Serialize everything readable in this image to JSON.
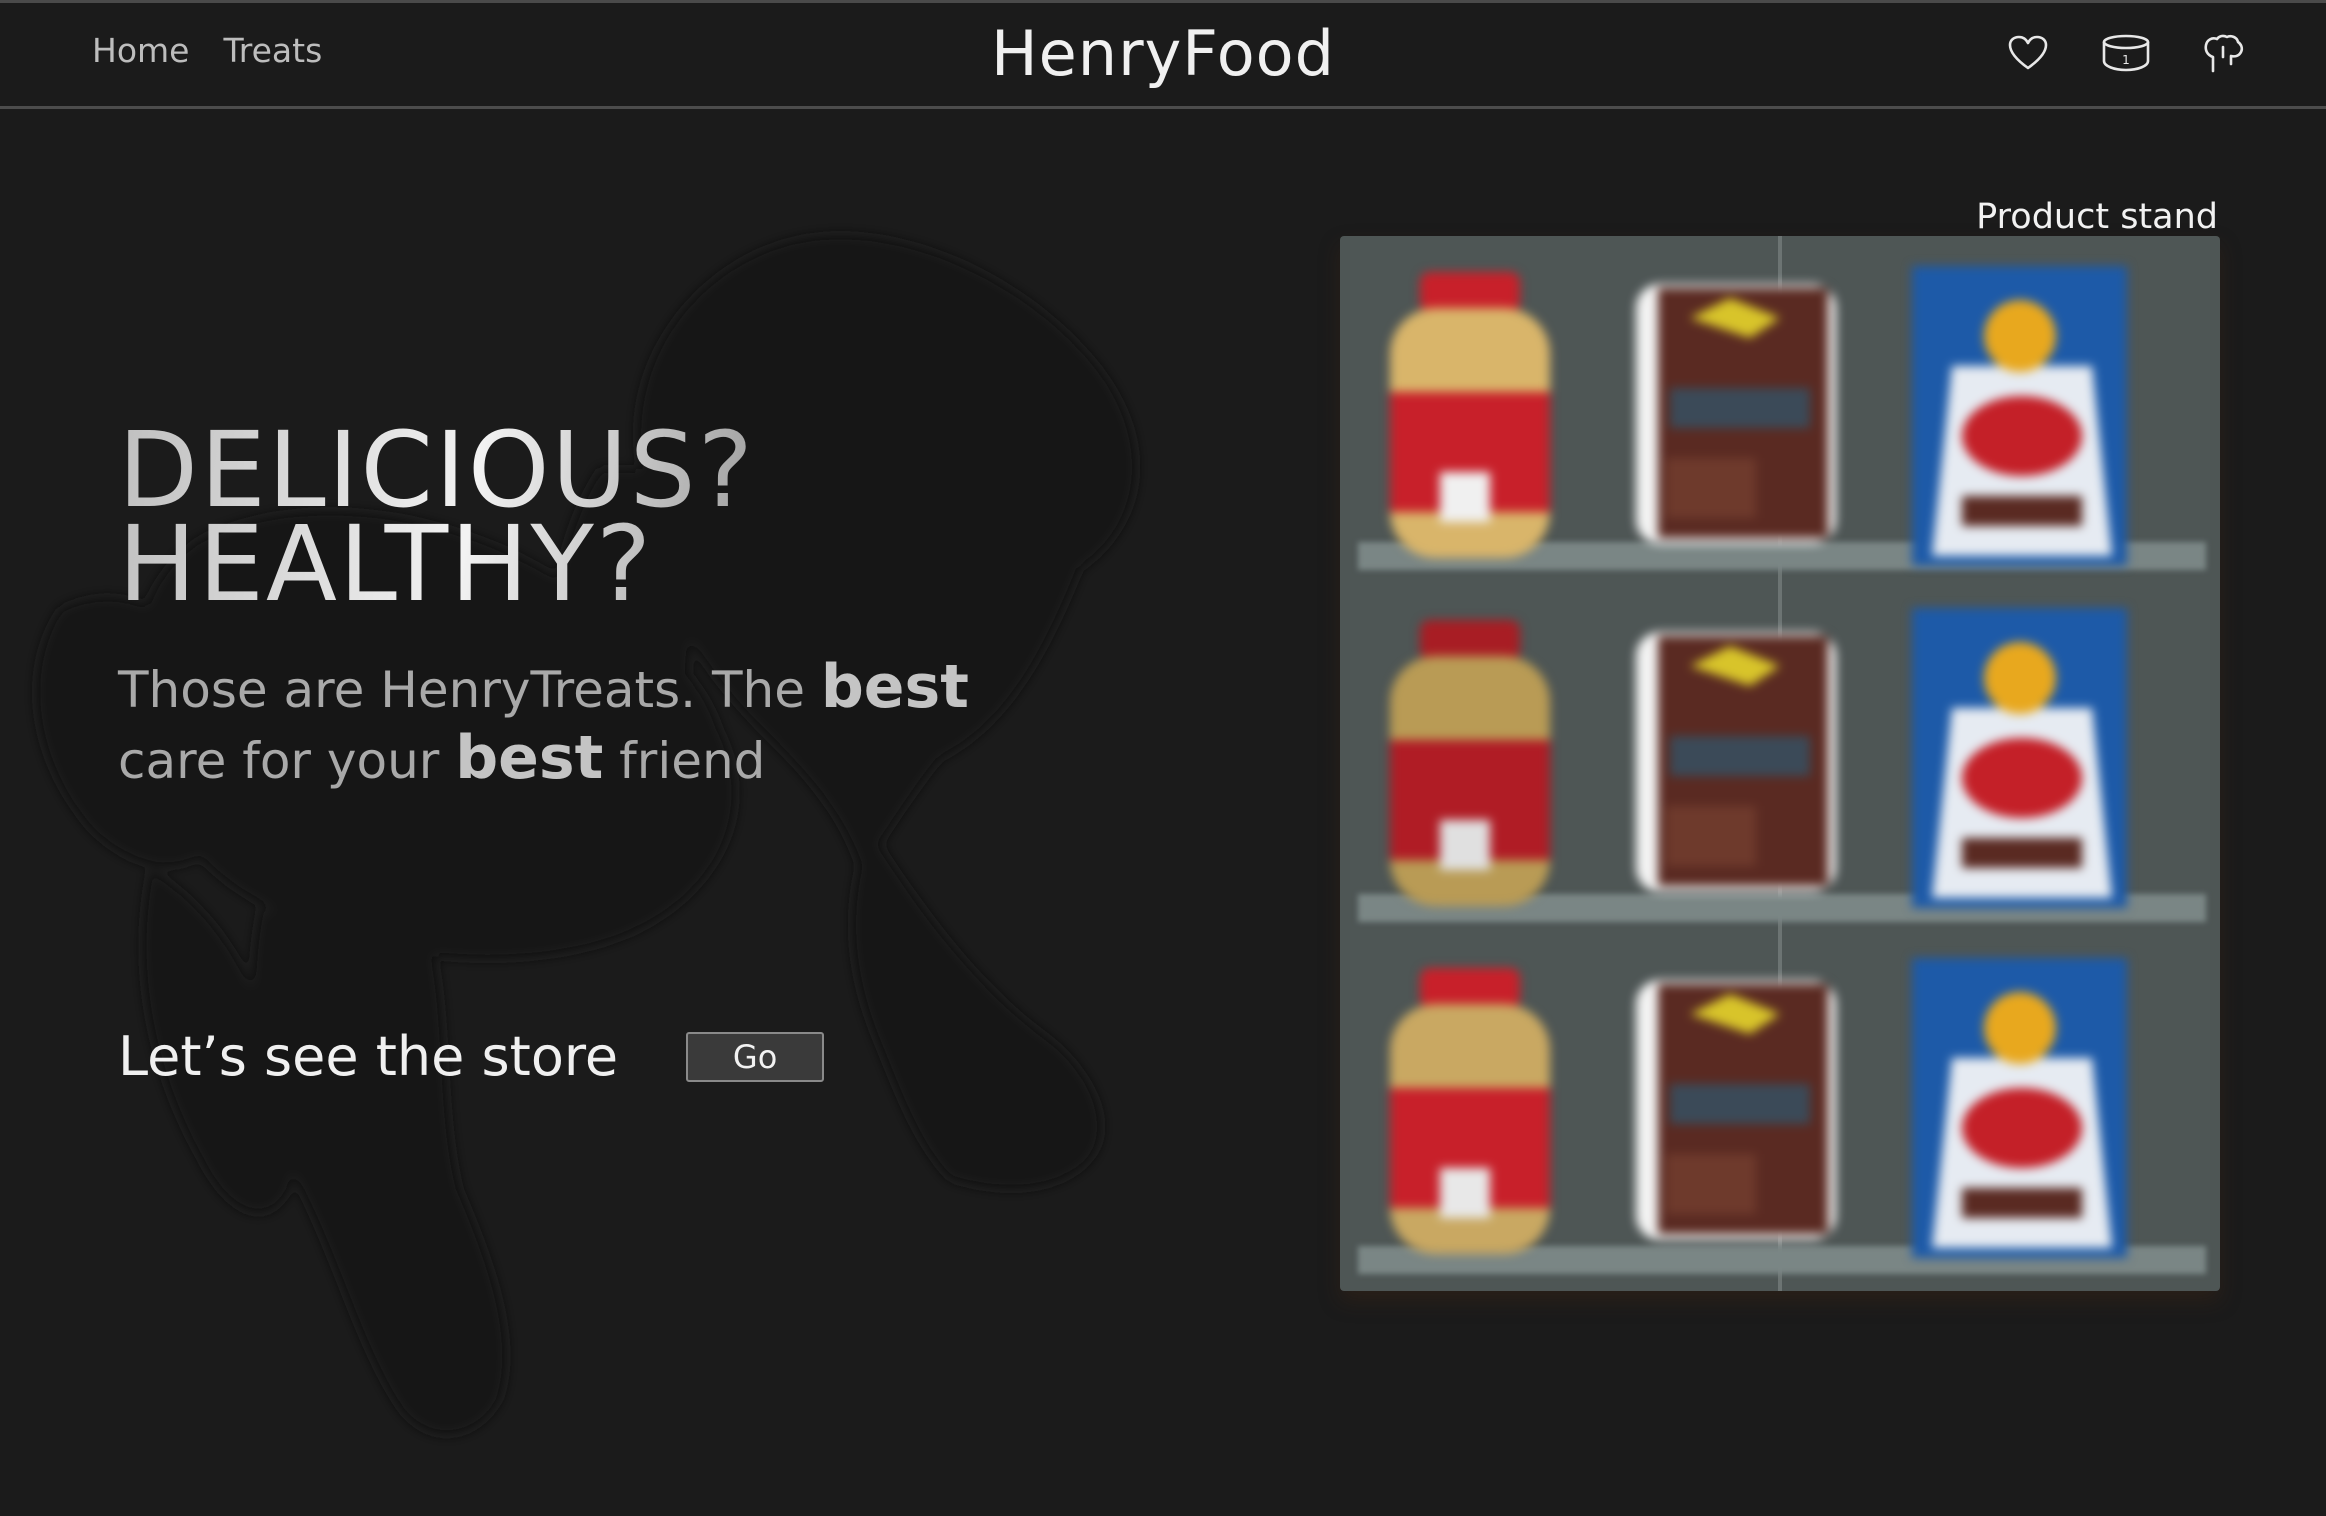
{
  "header": {
    "brand": "HenryFood",
    "nav": [
      {
        "label": "Home"
      },
      {
        "label": "Treats"
      }
    ],
    "icons": [
      "heart-icon",
      "bowl-icon",
      "paw-icon"
    ],
    "bowl_count": "1"
  },
  "hero": {
    "headline_line1": "DELICIOUS?",
    "headline_line2": "HEALTHY?",
    "tagline_part1": "Those are HenryTreats. The ",
    "tagline_bold1": "best",
    "tagline_part2": " care for your ",
    "tagline_bold2": "best",
    "tagline_part3": " friend",
    "cta_label": "Let’s see the store",
    "cta_button": "Go"
  },
  "stand": {
    "label": "Product stand",
    "rows": [
      [
        "treat-jar",
        "beef-pouch",
        "blue-bag"
      ],
      [
        "treat-jar",
        "beef-pouch",
        "blue-bag"
      ],
      [
        "treat-jar",
        "beef-pouch",
        "blue-bag"
      ]
    ]
  },
  "colors": {
    "background": "#1b1b1b",
    "stand_bg": "#4e5655",
    "jar_red": "#c8202a",
    "pouch_brown": "#5a2a22",
    "bag_blue": "#1d5aa8"
  }
}
